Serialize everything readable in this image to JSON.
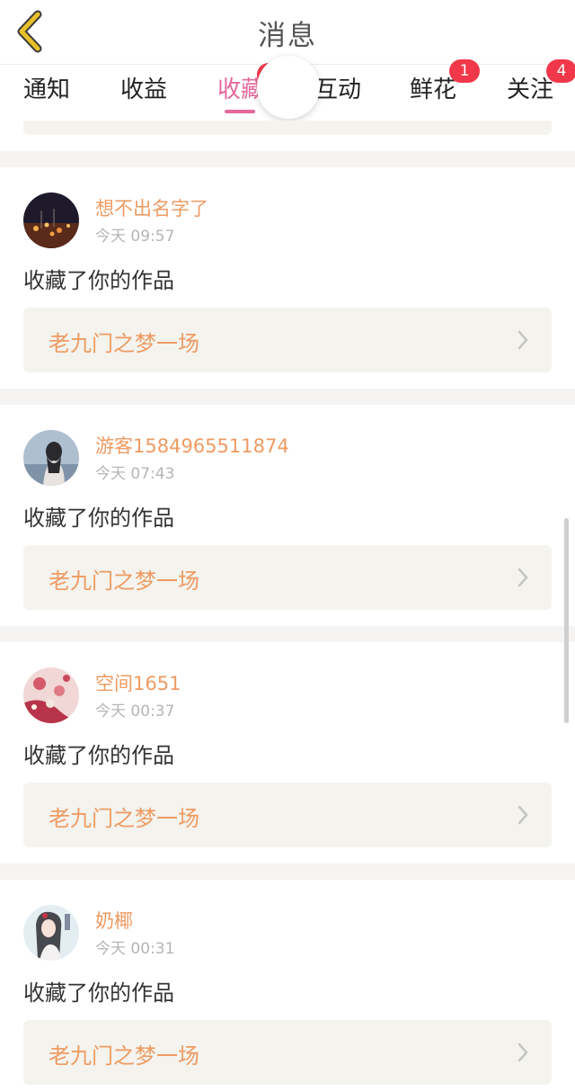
{
  "header": {
    "title": "消息",
    "back_icon": "chevron-left-icon",
    "accent_color": "#e8c12a"
  },
  "tabs": [
    {
      "label": "通知",
      "badge": ""
    },
    {
      "label": "收益",
      "badge": ""
    },
    {
      "label": "收藏",
      "badge": "",
      "active": true
    },
    {
      "label": "互动",
      "badge": ""
    },
    {
      "label": "鲜花",
      "badge": "1"
    },
    {
      "label": "关注",
      "badge": "4"
    }
  ],
  "active_tab_color": "#e5679b",
  "badge_color": "#f1384a",
  "notifications": [
    {
      "username": "想不出名字了",
      "time": "今天 09:57",
      "action": "收藏了你的作品",
      "work_title": "老九门之梦一场"
    },
    {
      "username": "游客1584965511874",
      "time": "今天 07:43",
      "action": "收藏了你的作品",
      "work_title": "老九门之梦一场"
    },
    {
      "username": "空间1651",
      "time": "今天 00:37",
      "action": "收藏了你的作品",
      "work_title": "老九门之梦一场"
    },
    {
      "username": "奶椰",
      "time": "今天 00:31",
      "action": "收藏了你的作品",
      "work_title": "老九门之梦一场"
    }
  ],
  "name_color": "#ee9b62"
}
